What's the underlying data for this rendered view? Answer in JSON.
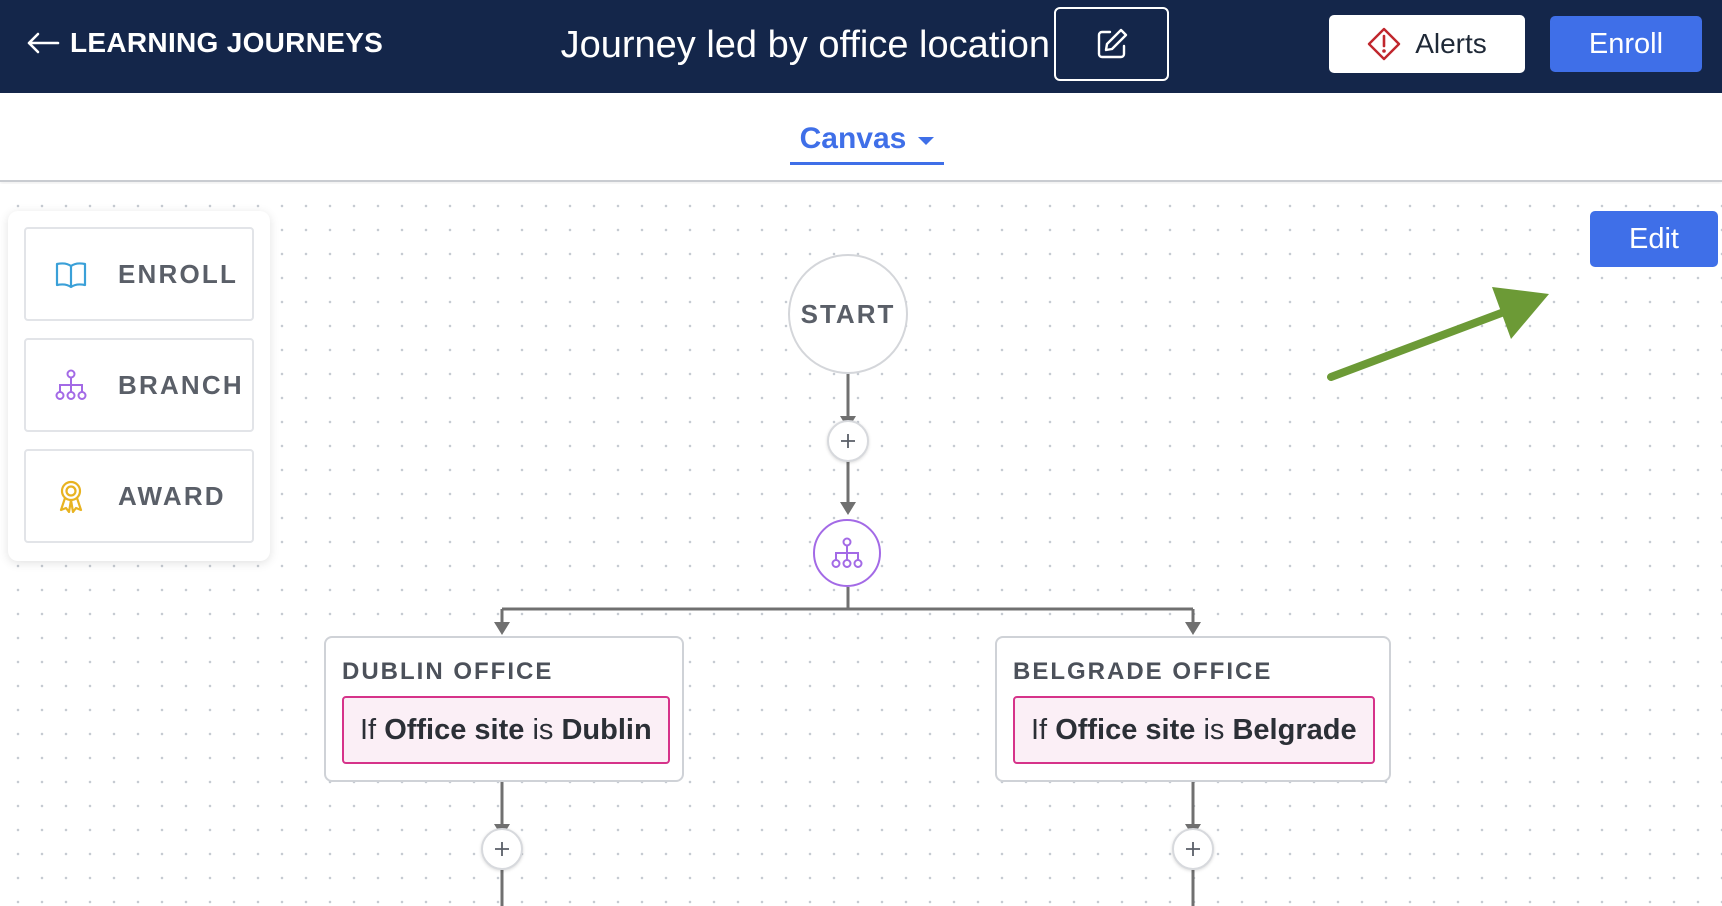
{
  "header": {
    "back_label": "LEARNING JOURNEYS",
    "title": "Journey led by office location",
    "alerts_label": "Alerts",
    "enroll_label": "Enroll"
  },
  "subheader": {
    "view_tab_label": "Canvas"
  },
  "palette": {
    "items": [
      {
        "label": "ENROLL",
        "icon": "book-icon"
      },
      {
        "label": "BRANCH",
        "icon": "branch-icon"
      },
      {
        "label": "AWARD",
        "icon": "award-icon"
      }
    ]
  },
  "canvas": {
    "edit_label": "Edit",
    "start_label": "START",
    "branches": [
      {
        "title": "DUBLIN OFFICE",
        "condition": {
          "prefix": "If",
          "field": "Office site",
          "operator": "is",
          "value": "Dublin"
        }
      },
      {
        "title": "BELGRADE OFFICE",
        "condition": {
          "prefix": "If",
          "field": "Office site",
          "operator": "is",
          "value": "Belgrade"
        }
      }
    ]
  },
  "colors": {
    "header_bg": "#14264a",
    "primary": "#3f6fe8",
    "branch_purple": "#a36ae6",
    "condition_border": "#d6338a",
    "condition_bg": "#fbeff6",
    "annotation_arrow": "#6c9a36"
  }
}
